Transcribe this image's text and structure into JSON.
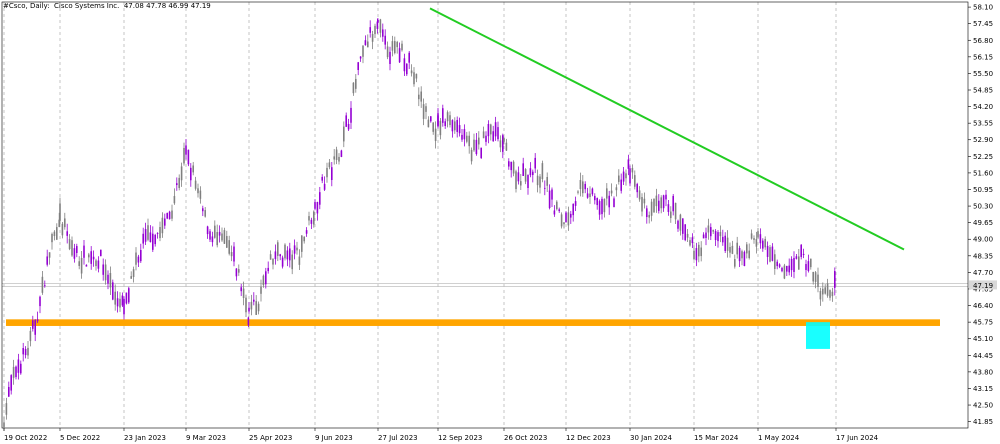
{
  "header": {
    "symbol": "#Csco",
    "timeframe": "Daily",
    "name": "Cisco Systems Inc.",
    "open": "47.08",
    "high": "47.78",
    "low": "46.99",
    "close": "47.19"
  },
  "chart_data": {
    "type": "candlestick",
    "x_ticks": [
      "19 Oct 2022",
      "5 Dec 2022",
      "23 Jan 2023",
      "9 Mar 2023",
      "25 Apr 2023",
      "9 Jun 2023",
      "27 Jul 2023",
      "12 Sep 2023",
      "26 Oct 2023",
      "12 Dec 2023",
      "30 Jan 2024",
      "15 Mar 2024",
      "1 May 2024",
      "17 Jun 2024"
    ],
    "y_ticks": [
      "58.10",
      "57.45",
      "56.80",
      "56.15",
      "55.50",
      "54.85",
      "54.20",
      "53.55",
      "52.90",
      "52.25",
      "51.60",
      "50.95",
      "50.30",
      "49.65",
      "49.00",
      "48.35",
      "47.70",
      "47.05",
      "46.40",
      "45.75",
      "45.10",
      "44.45",
      "43.80",
      "43.15",
      "42.50",
      "41.85"
    ],
    "current_price": "47.19",
    "ylim": [
      41.6,
      58.3
    ],
    "support_zone": [
      45.6,
      45.86
    ],
    "trendline": {
      "from": [
        "27 Jul 2023",
        58.05
      ],
      "to": [
        "17 Jun 2024",
        47.5
      ]
    },
    "highlight_zone": {
      "from": "1 May 2024",
      "to": "17 Jun 2024",
      "price_range": [
        44.7,
        45.75
      ]
    },
    "price_path": [
      [
        "19 Oct 2022",
        41.8
      ],
      [
        "5 Dec 2022",
        49.5
      ],
      [
        "23 Jan 2023",
        46.7
      ],
      [
        "9 Mar 2023",
        51.8
      ],
      [
        "25 Apr 2023",
        46.5
      ],
      [
        "9 Jun 2023",
        49.8
      ],
      [
        "27 Jul 2023",
        57.6
      ],
      [
        "12 Sep 2023",
        53.5
      ],
      [
        "26 Oct 2023",
        52.5
      ],
      [
        "12 Dec 2023",
        50.1
      ],
      [
        "30 Jan 2024",
        51.2
      ],
      [
        "15 Mar 2024",
        49.0
      ],
      [
        "1 May 2024",
        48.6
      ],
      [
        "17 Jun 2024",
        47.19
      ]
    ],
    "colors": {
      "up": "#7f7f7f",
      "down": "#9400d3",
      "trendline": "#22cc22",
      "support": "#ffa500",
      "highlight": "#00ffff",
      "grid": "#a0a0a0"
    }
  }
}
